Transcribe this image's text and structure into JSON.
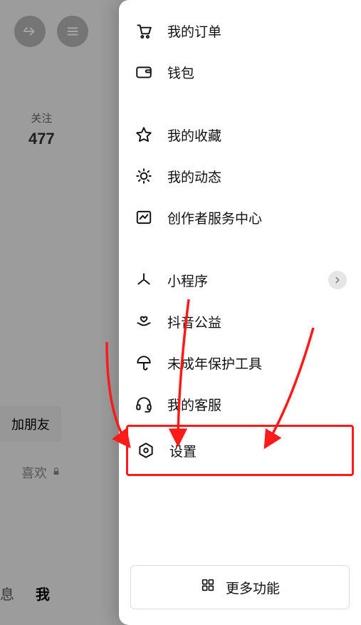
{
  "underlay": {
    "follow_label": "关注",
    "follow_count": "477",
    "add_friend": "加朋友",
    "like_label": "喜欢",
    "tab_msg": "息",
    "tab_me": "我"
  },
  "menu": {
    "orders": "我的订单",
    "wallet": "钱包",
    "favorites": "我的收藏",
    "moments": "我的动态",
    "creator": "创作者服务中心",
    "miniapp": "小程序",
    "charity": "抖音公益",
    "minor": "未成年保护工具",
    "support": "我的客服",
    "settings": "设置",
    "more": "更多功能"
  }
}
